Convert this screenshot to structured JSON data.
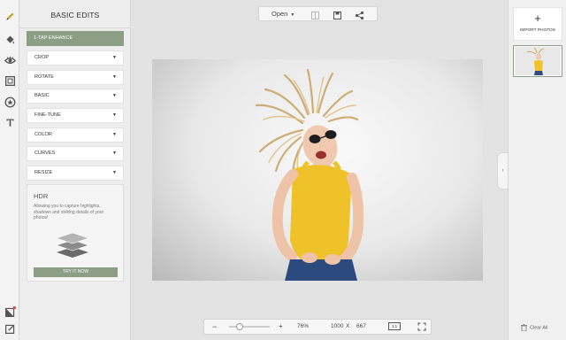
{
  "sidebar": {
    "title": "BASIC EDITS",
    "enhance_label": "1-TAP ENHANCE"
  },
  "menu": [
    {
      "label": "CROP"
    },
    {
      "label": "ROTATE"
    },
    {
      "label": "BASIC"
    },
    {
      "label": "FINE-TUNE"
    },
    {
      "label": "COLOR"
    },
    {
      "label": "CURVES"
    },
    {
      "label": "RESIZE"
    }
  ],
  "hdr": {
    "title": "HDR",
    "description": "Allowing you to capture highlights, shadows and striking details of your photos!",
    "button_label": "TRY IT NOW"
  },
  "toolbar": {
    "open_label": "Open",
    "icons": [
      "compare-icon",
      "save-icon",
      "share-icon"
    ]
  },
  "right_panel": {
    "import_plus": "+",
    "import_label": "IMPORT PHOTOS",
    "clear_label": "Clear All"
  },
  "zoom": {
    "minus": "−",
    "plus": "+",
    "percent_label": "76%",
    "percent": 76,
    "slider_level": 0.25,
    "width": "1000",
    "times": "X",
    "height": "667",
    "ratio_label": "1:1"
  },
  "rail_icons": [
    "pencil-icon",
    "fill-bucket-icon",
    "eye-icon",
    "frame-icon",
    "sticker-icon",
    "text-icon",
    "overlay-icon",
    "edit-export-icon"
  ],
  "colors": {
    "accent": "#8d9e86",
    "shirt": "#f0c22a",
    "notification": "#e0463c"
  }
}
